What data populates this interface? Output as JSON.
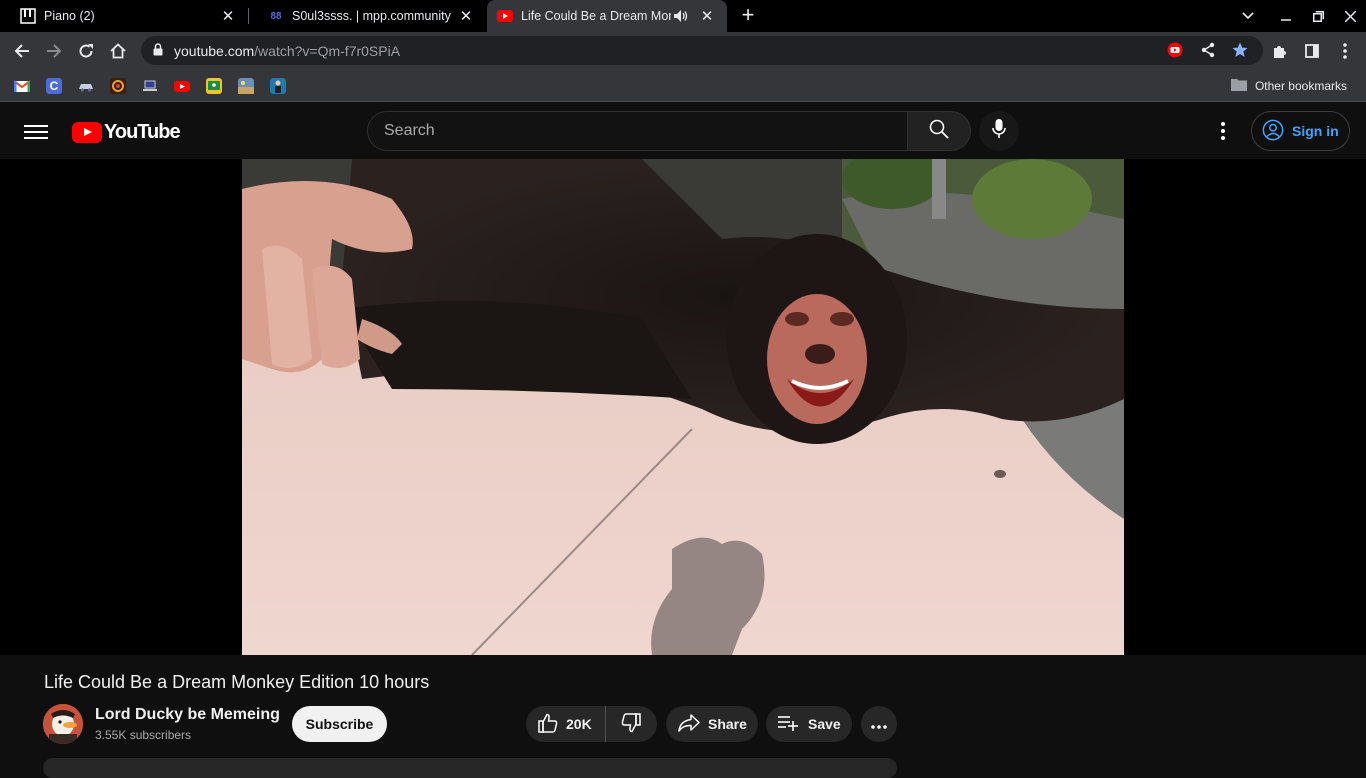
{
  "tabs": [
    {
      "title": "Piano (2)"
    },
    {
      "title": "S0ul3ssss. | mpp.community"
    },
    {
      "title": "Life Could Be a Dream Monk"
    }
  ],
  "address": {
    "host": "youtube.com",
    "path": "/watch?v=Qm-f7r0SPiA"
  },
  "bookmarks": {
    "other_label": "Other bookmarks"
  },
  "youtube": {
    "logo_text": "YouTube",
    "search_placeholder": "Search",
    "signin_label": "Sign in"
  },
  "video": {
    "title": "Life Could Be a Dream Monkey Edition 10 hours",
    "channel": "Lord Ducky be Memeing",
    "subscribers": "3.55K subscribers",
    "subscribe_label": "Subscribe",
    "likes": "20K",
    "share_label": "Share",
    "save_label": "Save"
  },
  "colors": {
    "accent_red": "#ff0000",
    "link_blue": "#3ea6ff",
    "bookmark_star": "#8ab4f8"
  }
}
